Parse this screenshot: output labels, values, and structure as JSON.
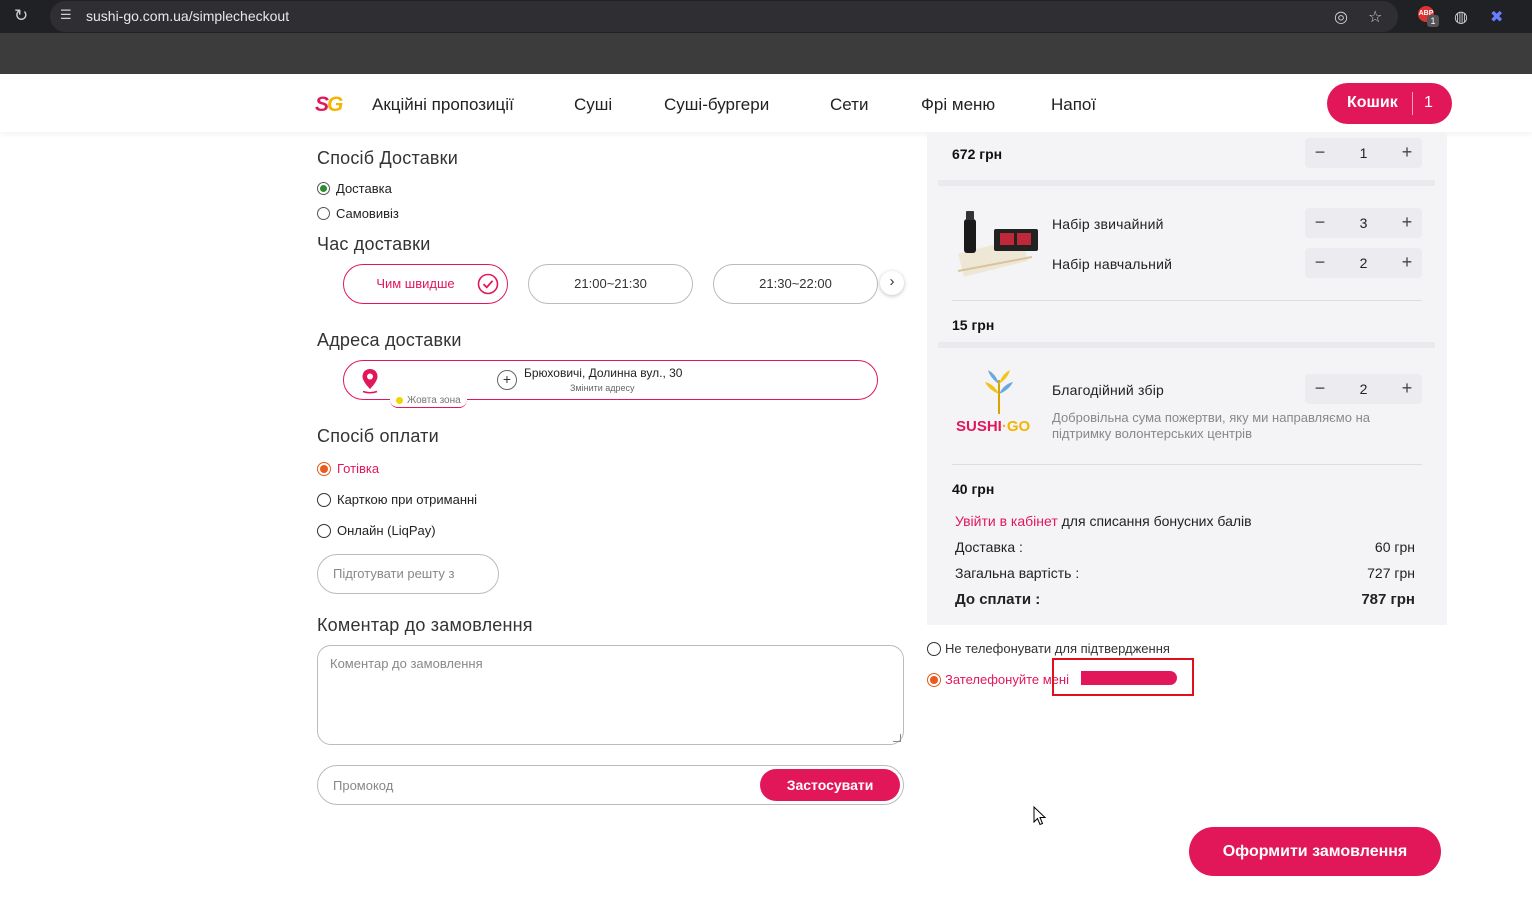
{
  "browser": {
    "url": "sushi-go.com.ua/simplecheckout",
    "extension_badge": "1"
  },
  "colors": {
    "brand": "#e2175a",
    "brand_yellow": "#f4b400",
    "radio_selected_orange": "#e85a1f",
    "radio_selected_green": "#2e8b2e",
    "panel_bg": "#f4f4f7"
  },
  "header": {
    "logo_s": "S",
    "logo_g": "G",
    "nav": [
      "Акційні пропозиції",
      "Суші",
      "Суші-бургери",
      "Сети",
      "Фрі меню",
      "Напої"
    ],
    "cart_label": "Кошик",
    "cart_count": "1"
  },
  "delivery_method": {
    "title": "Спосіб Доставки",
    "options": [
      "Доставка",
      "Самовивіз"
    ],
    "selected": "Доставка"
  },
  "delivery_time": {
    "title": "Час доставки",
    "slots": [
      "Чим швидше",
      "21:00~21:30",
      "21:30~22:00"
    ],
    "selected": "Чим швидше"
  },
  "address": {
    "title": "Адреса доставки",
    "value": "Брюховичі, Долинна вул., 30",
    "change_label": "Змінити адресу",
    "zone": "Жовта зона"
  },
  "payment": {
    "title": "Спосіб оплати",
    "options": [
      "Готівка",
      "Карткою при отриманні",
      "Онлайн (LiqPay)"
    ],
    "selected": "Готівка",
    "change_placeholder": "Підготувати решту з"
  },
  "comment": {
    "title": "Коментар до замовлення",
    "placeholder": "Коментар до замовлення"
  },
  "promo": {
    "placeholder": "Промокод",
    "apply_label": "Застосувати"
  },
  "cart": {
    "items": [
      {
        "price": "672 грн",
        "qty": "1"
      },
      {
        "price": "15 грн",
        "subitems": [
          {
            "name": "Набір звичайний",
            "qty": "3"
          },
          {
            "name": "Набір навчальний",
            "qty": "2"
          }
        ]
      },
      {
        "price": "40 грн",
        "name": "Благодійний збір",
        "desc": "Добровільна сума пожертви, яку ми направляємо на підтримку волонтерських центрів",
        "qty": "2",
        "logo_text_a": "SUSHI",
        "logo_text_b": "GO"
      }
    ],
    "login_link": "Увійти в кабінет",
    "login_rest": " для списання бонусних балів",
    "delivery_label": "Доставка :",
    "delivery_value": "60 грн",
    "subtotal_label": "Загальна вартість :",
    "subtotal_value": "727 грн",
    "total_label": "До сплати :",
    "total_value": "787 грн"
  },
  "confirmation": {
    "options": [
      "Не телефонувати для підтвердження",
      "Зателефонуйте мені"
    ],
    "selected": "Зателефонуйте мені"
  },
  "checkout_label": "Оформити замовлення"
}
